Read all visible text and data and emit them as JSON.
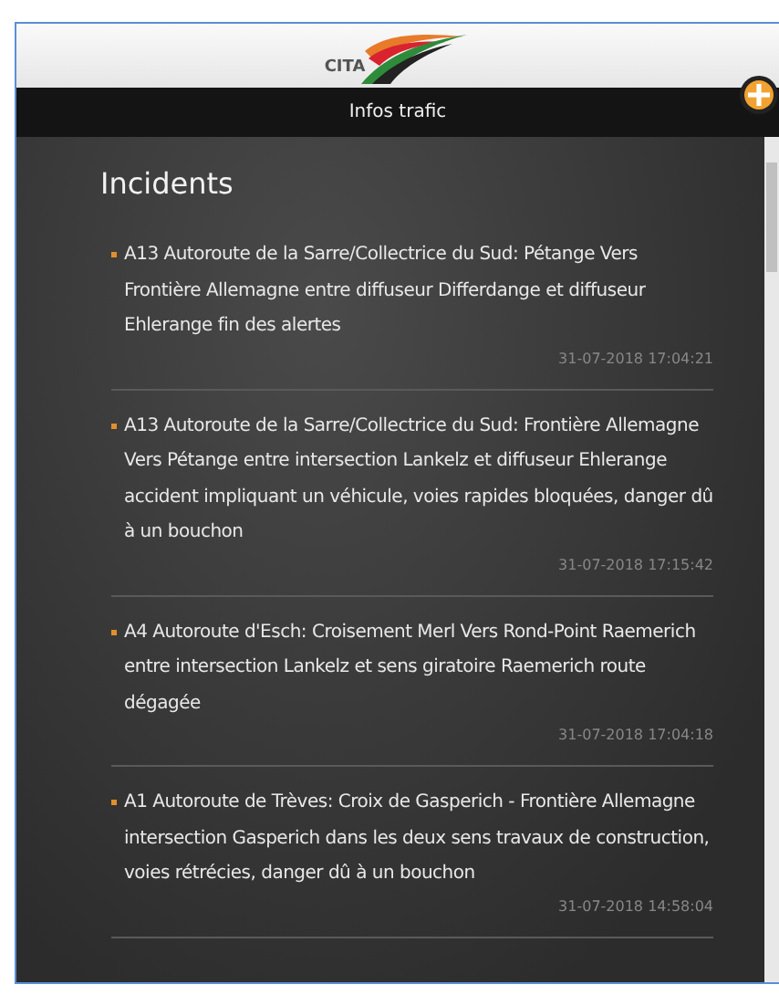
{
  "header": {
    "logo_text": "CITA"
  },
  "nav_bar": {
    "title": "Infos trafic"
  },
  "section_title": "Incidents",
  "incidents": [
    {
      "text": "A13 Autoroute de la Sarre/Collectrice du Sud: Pétange Vers Frontière Allemagne entre diffuseur Differdange et diffuseur Ehlerange fin des alertes",
      "time": "31-07-2018 17:04:21"
    },
    {
      "text": "A13 Autoroute de la Sarre/Collectrice du Sud: Frontière Allemagne Vers Pétange entre intersection Lankelz et diffuseur Ehlerange accident impliquant un véhicule, voies rapides bloquées, danger dû à un bouchon",
      "time": "31-07-2018 17:15:42"
    },
    {
      "text": "A4 Autoroute d'Esch: Croisement Merl Vers Rond-Point Raemerich entre intersection Lankelz et sens giratoire Raemerich route dégagée",
      "time": "31-07-2018 17:04:18"
    },
    {
      "text": "A1 Autoroute de Trèves: Croix de Gasperich - Frontière Allemagne intersection Gasperich dans les deux sens travaux de construction, voies rétrécies, danger dû à un bouchon",
      "time": "31-07-2018 14:58:04"
    }
  ]
}
